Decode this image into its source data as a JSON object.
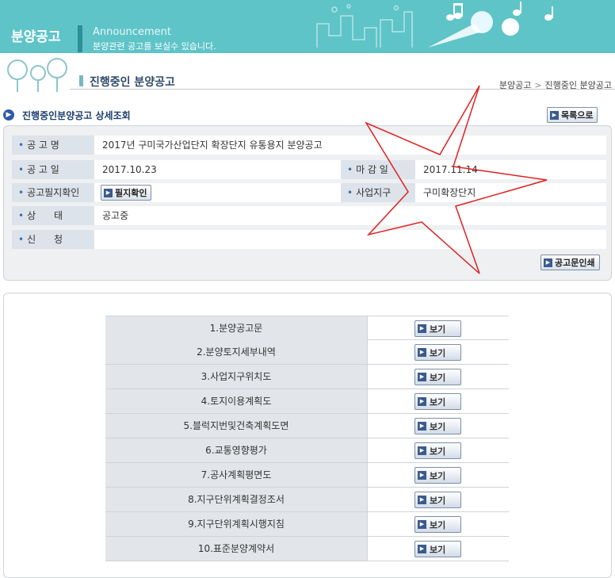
{
  "banner": {
    "title": "분양공고",
    "subtitle_en": "Announcement",
    "subtitle_kr": "분양관련 공고를 보실수 있습니다."
  },
  "page": {
    "heading": "진행중인 분양공고",
    "breadcrumb": [
      "분양공고",
      "진행중인 분양공고"
    ],
    "breadcrumb_sep": ">",
    "section_title": "진행중인분양공고 상세조회"
  },
  "buttons": {
    "list": "목록으로",
    "print": "공고문인쇄",
    "parcel": "필지확인",
    "view": "보기"
  },
  "details": {
    "name_label": "공 고 명",
    "name_value": "2017년 구미국가산업단지 확장단지 유통용지 분양공고",
    "date_label": "공 고 일",
    "date_value": "2017.10.23",
    "deadline_label": "마 감 일",
    "deadline_value": "2017.11.14",
    "parcel_label": "공고필지확인",
    "district_label": "사업지구",
    "district_value": "구미확장단지",
    "status_label": "상      태",
    "status_value": "공고중",
    "apply_label": "신      청",
    "apply_value": ""
  },
  "documents": [
    "1.분양공고문",
    "2.분양토지세부내역",
    "3.사업지구위치도",
    "4.토지이용계획도",
    "5.블럭지번및건축계획도면",
    "6.교통영향평가",
    "7.공사계획평면도",
    "8.지구단위계획결정조서",
    "9.지구단위계획시행지침",
    "10.표준분양계약서"
  ],
  "icons": {
    "bullet": "dot-icon",
    "button_arrow": "play-triangle-icon",
    "section": "chevron-right-circle-icon"
  },
  "colors": {
    "banner": "#5ec4c8",
    "label_bg": "#dde3ea",
    "accent": "#2e5aa8",
    "star_stroke": "#e02020"
  }
}
